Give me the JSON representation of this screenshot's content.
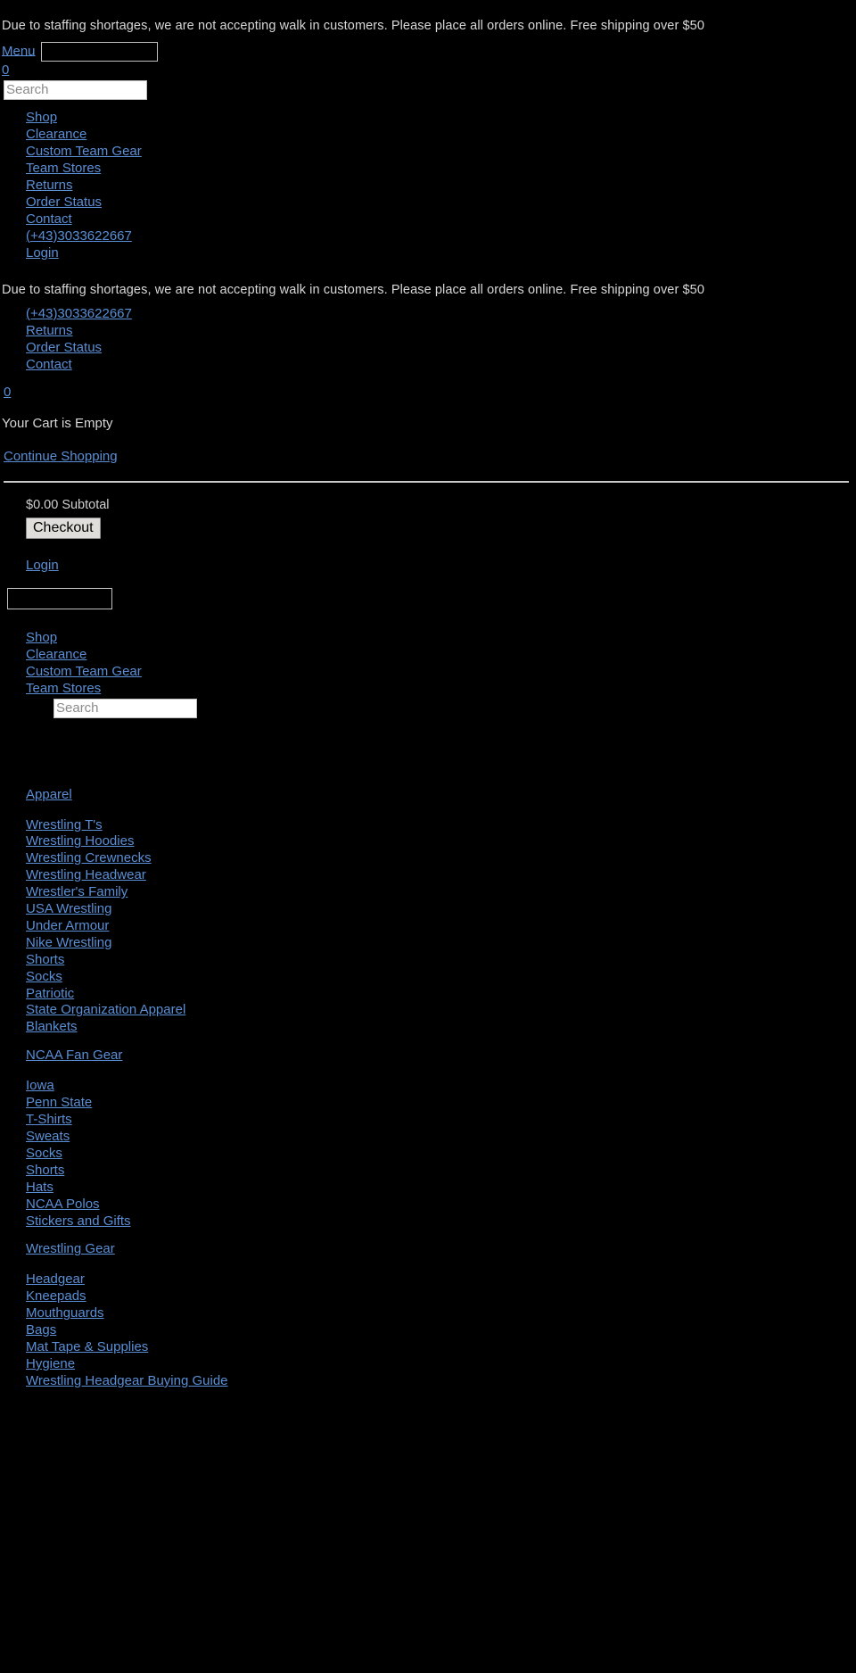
{
  "announcement": {
    "text": "Due to staffing shortages, we are not accepting walk in customers.  Please place all orders online.  Free shipping over $50"
  },
  "header": {
    "menu_label": "Menu",
    "menu_input_value": "",
    "cart_count": "0",
    "search_placeholder": "Search",
    "search_value": ""
  },
  "primary_nav": {
    "items": [
      {
        "label": "Shop"
      },
      {
        "label": "Clearance"
      },
      {
        "label": "Custom Team Gear"
      },
      {
        "label": "Team Stores"
      },
      {
        "label": "Returns"
      },
      {
        "label": "Order Status"
      },
      {
        "label": "Contact"
      },
      {
        "label": "(+43)3033622667"
      },
      {
        "label": "Login"
      }
    ]
  },
  "secondary_nav": {
    "items": [
      {
        "label": "(+43)3033622667"
      },
      {
        "label": "Returns"
      },
      {
        "label": "Order Status"
      },
      {
        "label": "Contact"
      }
    ]
  },
  "cart": {
    "count": "0",
    "empty_message": "Your Cart is Empty",
    "continue_label": "Continue Shopping",
    "subtotal_text": "$0.00 Subtotal",
    "checkout_label": "Checkout"
  },
  "account": {
    "login_label": "Login",
    "login_input_value": ""
  },
  "shop_nav": {
    "items": [
      {
        "label": "Shop"
      },
      {
        "label": "Clearance"
      },
      {
        "label": "Custom Team Gear"
      },
      {
        "label": "Team Stores"
      }
    ],
    "search_placeholder": "Search",
    "search_value": ""
  },
  "categories": [
    {
      "heading": "Apparel",
      "items": [
        {
          "label": "Wrestling T's"
        },
        {
          "label": "Wrestling Hoodies"
        },
        {
          "label": "Wrestling Crewnecks"
        },
        {
          "label": "Wrestling Headwear"
        },
        {
          "label": "Wrestler's Family"
        },
        {
          "label": "USA Wrestling"
        },
        {
          "label": "Under Armour"
        },
        {
          "label": "Nike Wrestling"
        },
        {
          "label": "Shorts"
        },
        {
          "label": "Socks"
        },
        {
          "label": "Patriotic"
        },
        {
          "label": "State Organization Apparel"
        },
        {
          "label": "Blankets"
        }
      ]
    },
    {
      "heading": "NCAA Fan Gear",
      "items": [
        {
          "label": "Iowa"
        },
        {
          "label": "Penn State"
        },
        {
          "label": "T-Shirts"
        },
        {
          "label": "Sweats"
        },
        {
          "label": "Socks"
        },
        {
          "label": "Shorts"
        },
        {
          "label": "Hats"
        },
        {
          "label": "NCAA Polos"
        },
        {
          "label": "Stickers and Gifts"
        }
      ]
    },
    {
      "heading": "Wrestling Gear",
      "items": [
        {
          "label": "Headgear"
        },
        {
          "label": "Kneepads"
        },
        {
          "label": "Mouthguards"
        },
        {
          "label": "Bags"
        },
        {
          "label": "Mat Tape & Supplies"
        },
        {
          "label": "Hygiene"
        },
        {
          "label": "Wrestling Headgear Buying Guide"
        }
      ]
    }
  ],
  "colors": {
    "background": "#000000",
    "link": "#5a8fd6",
    "text": "#d8d8d8",
    "button_bg": "#e0dedb"
  }
}
